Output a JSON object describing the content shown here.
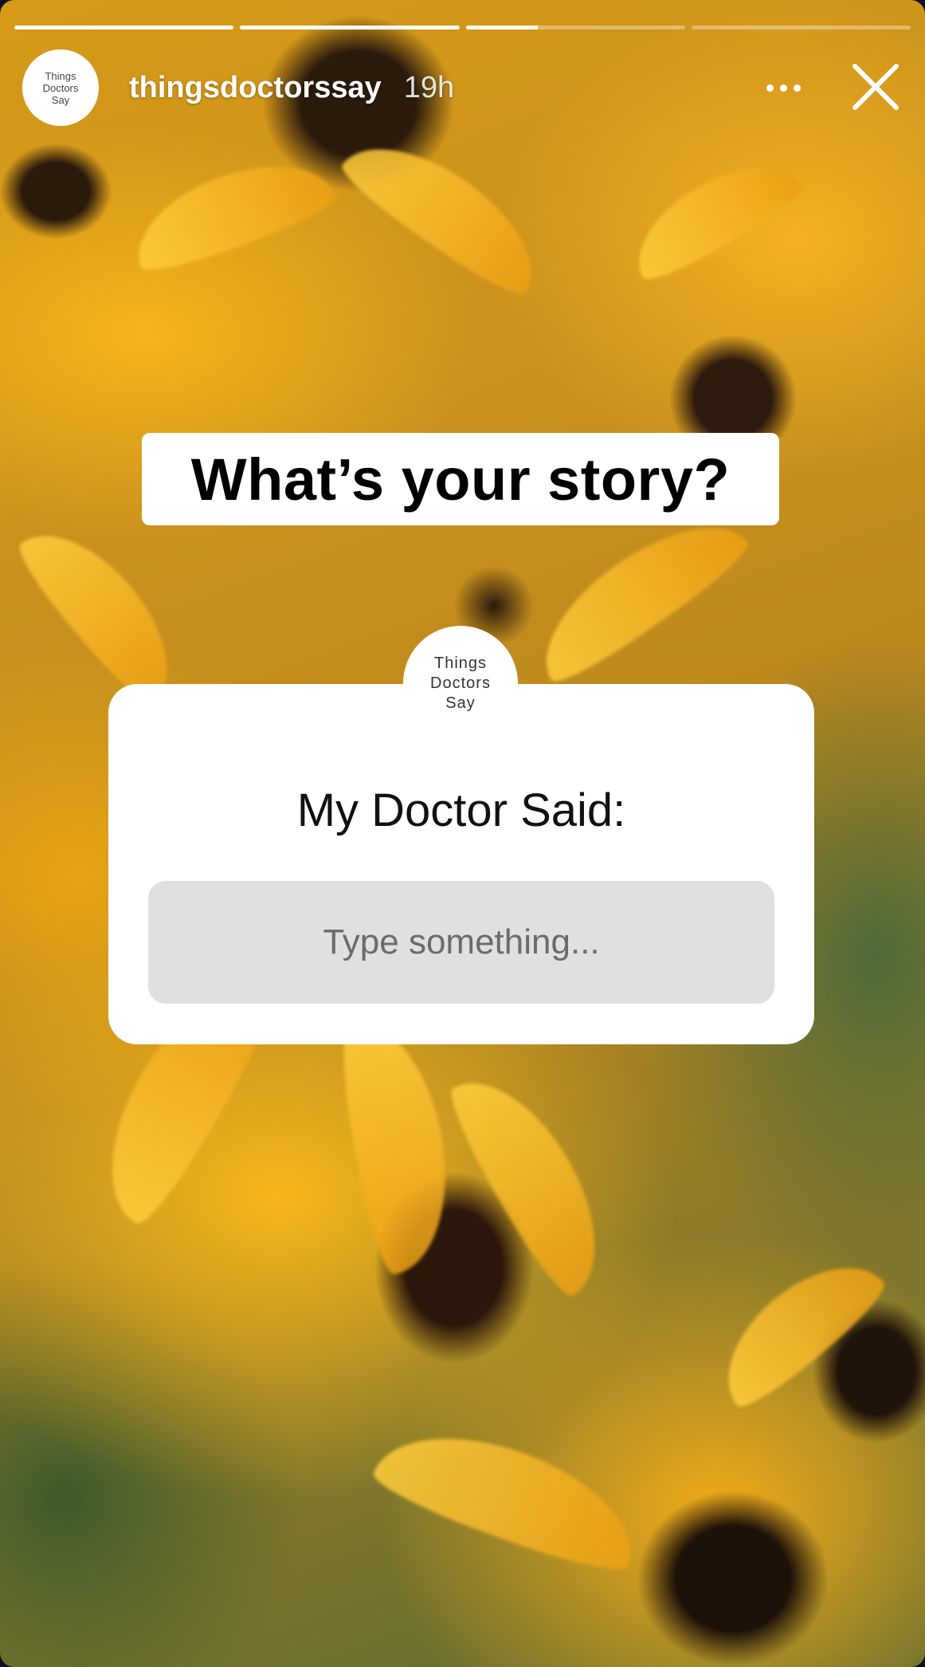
{
  "progress": {
    "segments": [
      1.0,
      1.0,
      0.33,
      0.0
    ]
  },
  "header": {
    "avatar_text": "Things\nDoctors\nSay",
    "username": "thingsdoctorssay",
    "time": "19h",
    "more_icon": "more-horizontal-icon",
    "close_icon": "close-icon"
  },
  "story": {
    "title": "What’s your story?",
    "question": {
      "avatar_text": "Things\nDoctors\nSay",
      "prompt": "My Doctor Said:",
      "placeholder": "Type something..."
    }
  },
  "colors": {
    "progress_fill": "#ffffff",
    "card_bg": "#ffffff",
    "field_bg": "#e0e0e0",
    "placeholder": "#6b6b6b"
  }
}
